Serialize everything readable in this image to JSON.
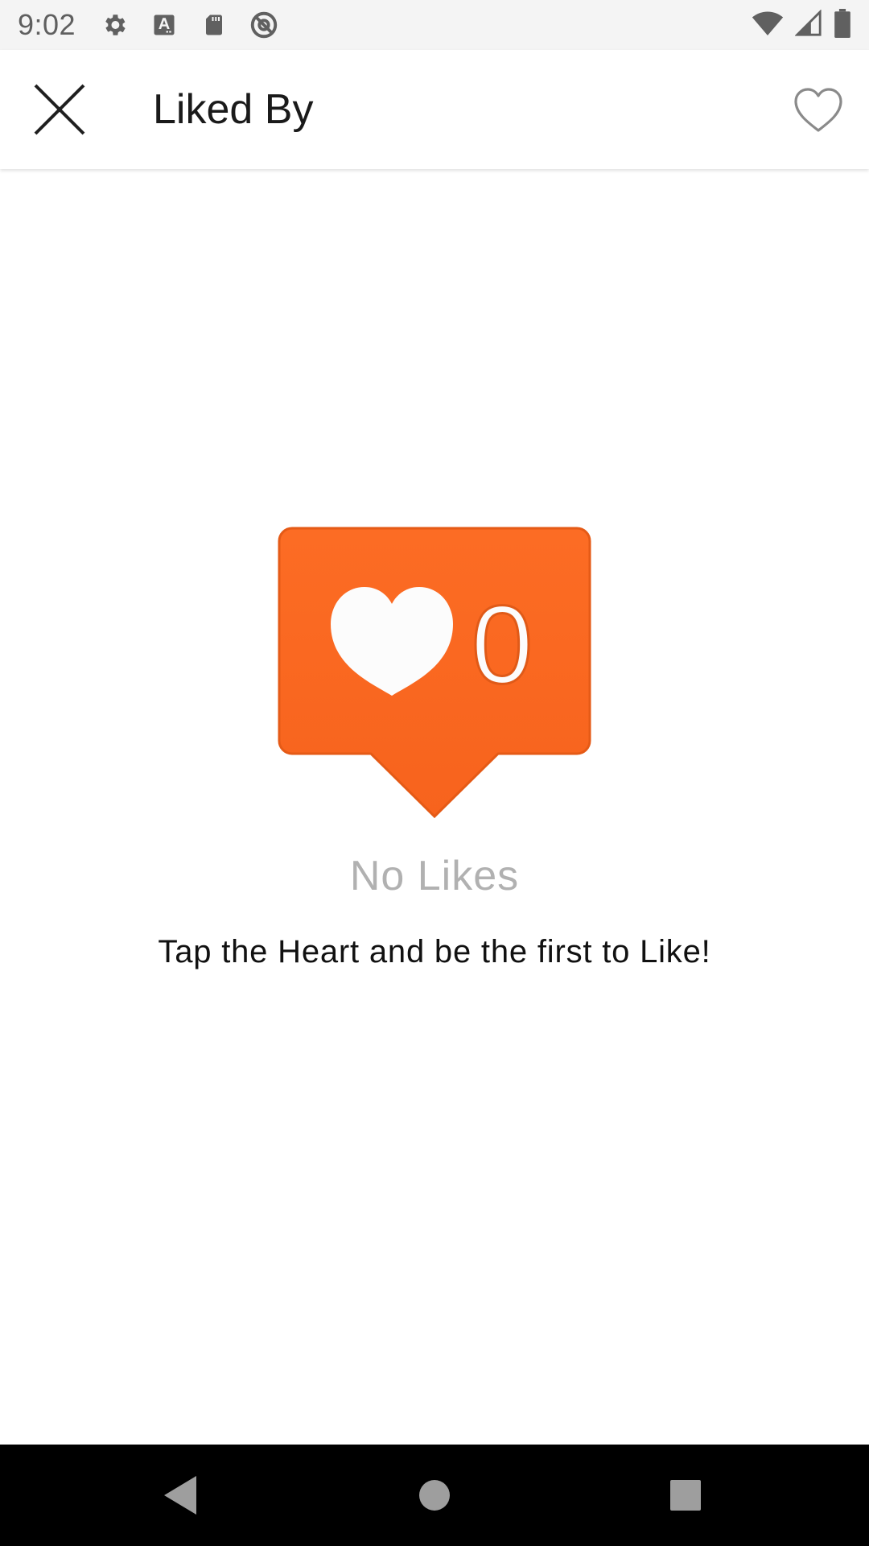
{
  "status_bar": {
    "time": "9:02",
    "left_icons": [
      "settings-icon",
      "font-download-icon",
      "sd-card-icon",
      "do-not-disturb-icon"
    ],
    "right_icons": [
      "wifi-icon",
      "cell-signal-icon",
      "battery-icon"
    ]
  },
  "app_bar": {
    "title": "Liked By",
    "close_icon": "close-icon",
    "like_icon": "heart-outline-icon"
  },
  "empty_state": {
    "like_count": "0",
    "title": "No Likes",
    "subtitle": "Tap the Heart and be the first to Like!",
    "badge_color": "#f96a24"
  },
  "nav_bar": {
    "buttons": [
      "back-icon",
      "home-icon",
      "recents-icon"
    ]
  }
}
